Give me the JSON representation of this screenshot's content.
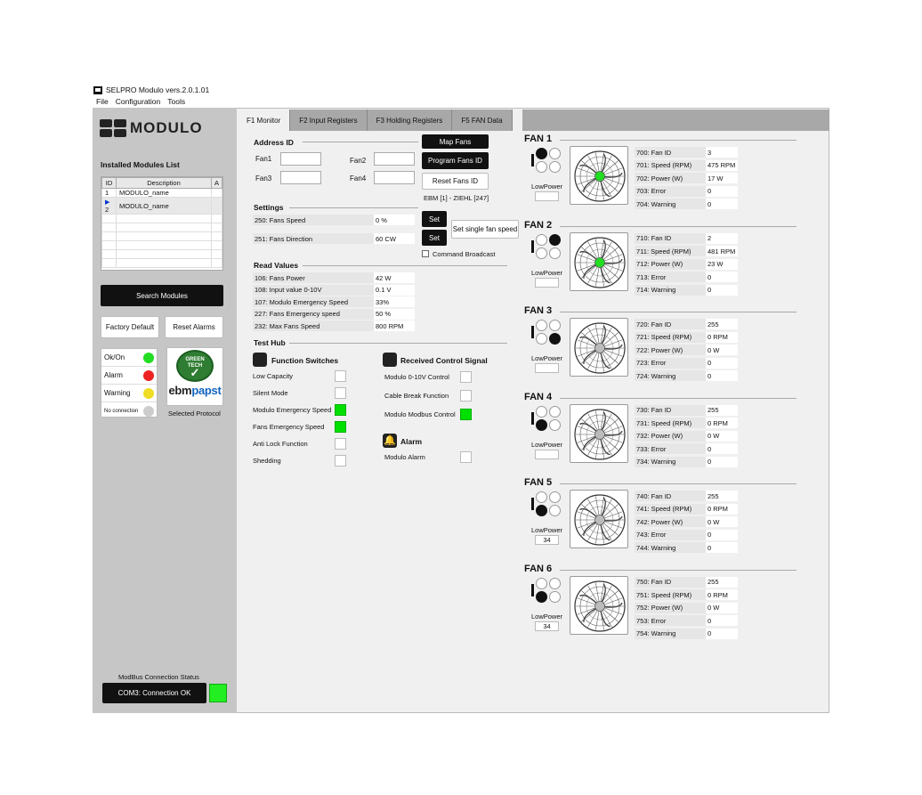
{
  "app": {
    "title": "SELPRO Modulo vers.2.0.1.01",
    "menu": [
      "File",
      "Configuration",
      "Tools"
    ],
    "logo_text": "MODULO"
  },
  "sidebar": {
    "installed_title": "Installed Modules List",
    "columns": [
      "ID",
      "Description",
      "A"
    ],
    "rows": [
      {
        "id": "1",
        "desc": "MODULO_name"
      },
      {
        "id": "2",
        "desc": "MODULO_name"
      }
    ],
    "search_button": "Search Modules",
    "factory_button": "Factory Default",
    "reset_alarms_button": "Reset Alarms",
    "legend": [
      {
        "label": "Ok/On",
        "color": "#22dd22"
      },
      {
        "label": "Alarm",
        "color": "#ee2222"
      },
      {
        "label": "Warning",
        "color": "#eedd22"
      },
      {
        "label": "No connection",
        "color": "#cccccc"
      }
    ],
    "badge_text": [
      "GREEN",
      "TECH"
    ],
    "ebm_text_a": "ebm",
    "ebm_text_b": "papst",
    "selected_protocol": "Selected Protocol",
    "modbus_status_title": "ModBus Connection Status",
    "modbus_status_button": "COM3: Connection OK",
    "modbus_status_color": "#22ee22"
  },
  "tabs": [
    "F1 Monitor",
    "F2 Input Registers",
    "F3 Holding Registers",
    "F5 FAN Data"
  ],
  "address": {
    "title": "Address ID",
    "fan_labels": [
      "Fan1",
      "Fan2",
      "Fan3",
      "Fan4"
    ],
    "map_button": "Map Fans",
    "program_button": "Program Fans ID",
    "reset_button": "Reset Fans ID",
    "ebm_info": "EBM [1] - ZIEHL [247]"
  },
  "settings": {
    "title": "Settings",
    "rows": [
      {
        "label": "250: Fans Speed",
        "value": "0 %"
      },
      {
        "label": "251: Fans Direction",
        "value": "60 CW"
      }
    ],
    "set_label": "Set",
    "single_speed_button": "Set single fan speed",
    "command_broadcast": "Command Broadcast"
  },
  "read_values": {
    "title": "Read Values",
    "rows": [
      {
        "label": "106: Fans Power",
        "value": "42 W"
      },
      {
        "label": "108: Input value 0-10V",
        "value": "0.1 V"
      },
      {
        "label": "107: Modulo Emergency Speed",
        "value": "33%"
      },
      {
        "label": "227: Fans Emergency speed",
        "value": "50 %"
      },
      {
        "label": "232: Max Fans Speed",
        "value": "800 RPM"
      }
    ]
  },
  "test_hub": {
    "title": "Test Hub",
    "function_switches_title": "Function Switches",
    "function_switches": [
      {
        "label": "Low Capacity",
        "on": false
      },
      {
        "label": "Silent Mode",
        "on": false
      },
      {
        "label": "Modulo Emergency Speed",
        "on": true
      },
      {
        "label": "Fans Emergency Speed",
        "on": true
      },
      {
        "label": "Anti Lock Function",
        "on": false
      },
      {
        "label": "Shedding",
        "on": false
      }
    ],
    "received_title": "Received Control Signal",
    "received": [
      {
        "label": "Modulo 0-10V Control",
        "on": false
      },
      {
        "label": "Cable Break Function",
        "on": false
      },
      {
        "label": "Modulo Modbus Control",
        "on": true
      }
    ],
    "alarm_title": "Alarm",
    "alarm": [
      {
        "label": "Modulo Alarm",
        "on": false
      }
    ]
  },
  "fans": [
    {
      "title": "FAN 1",
      "pad": [
        true,
        false,
        false,
        false
      ],
      "hub_green": true,
      "lowpower": "LowPower",
      "lowpower_value": "",
      "rows": [
        {
          "k": "700: Fan ID",
          "v": "3"
        },
        {
          "k": "701: Speed (RPM)",
          "v": "475 RPM"
        },
        {
          "k": "702: Power (W)",
          "v": "17 W"
        },
        {
          "k": "703: Error",
          "v": "0"
        },
        {
          "k": "704: Warning",
          "v": "0"
        }
      ]
    },
    {
      "title": "FAN 2",
      "pad": [
        false,
        true,
        false,
        false
      ],
      "hub_green": true,
      "lowpower": "LowPower",
      "lowpower_value": "",
      "rows": [
        {
          "k": "710: Fan ID",
          "v": "2"
        },
        {
          "k": "711: Speed (RPM)",
          "v": "481 RPM"
        },
        {
          "k": "712: Power (W)",
          "v": "23 W"
        },
        {
          "k": "713: Error",
          "v": "0"
        },
        {
          "k": "714: Warning",
          "v": "0"
        }
      ]
    },
    {
      "title": "FAN 3",
      "pad": [
        false,
        false,
        false,
        true
      ],
      "hub_green": false,
      "lowpower": "LowPower",
      "lowpower_value": "",
      "rows": [
        {
          "k": "720: Fan ID",
          "v": "255"
        },
        {
          "k": "721: Speed (RPM)",
          "v": "0 RPM"
        },
        {
          "k": "722: Power (W)",
          "v": "0 W"
        },
        {
          "k": "723: Error",
          "v": "0"
        },
        {
          "k": "724: Warning",
          "v": "0"
        }
      ]
    },
    {
      "title": "FAN 4",
      "pad": [
        false,
        false,
        true,
        false
      ],
      "hub_green": false,
      "lowpower": "LowPower",
      "lowpower_value": "",
      "rows": [
        {
          "k": "730: Fan ID",
          "v": "255"
        },
        {
          "k": "731: Speed (RPM)",
          "v": "0 RPM"
        },
        {
          "k": "732: Power (W)",
          "v": "0 W"
        },
        {
          "k": "733: Error",
          "v": "0"
        },
        {
          "k": "734: Warning",
          "v": "0"
        }
      ]
    },
    {
      "title": "FAN 5",
      "pad": [
        false,
        false,
        true,
        false
      ],
      "hub_green": false,
      "lowpower": "LowPower",
      "lowpower_value": "34",
      "rows": [
        {
          "k": "740: Fan ID",
          "v": "255"
        },
        {
          "k": "741: Speed (RPM)",
          "v": "0 RPM"
        },
        {
          "k": "742: Power (W)",
          "v": "0 W"
        },
        {
          "k": "743: Error",
          "v": "0"
        },
        {
          "k": "744: Warning",
          "v": "0"
        }
      ]
    },
    {
      "title": "FAN 6",
      "pad": [
        false,
        false,
        true,
        false
      ],
      "hub_green": false,
      "lowpower": "LowPower",
      "lowpower_value": "34",
      "rows": [
        {
          "k": "750: Fan ID",
          "v": "255"
        },
        {
          "k": "751: Speed (RPM)",
          "v": "0 RPM"
        },
        {
          "k": "752: Power (W)",
          "v": "0 W"
        },
        {
          "k": "753: Error",
          "v": "0"
        },
        {
          "k": "754: Warning",
          "v": "0"
        }
      ]
    }
  ]
}
